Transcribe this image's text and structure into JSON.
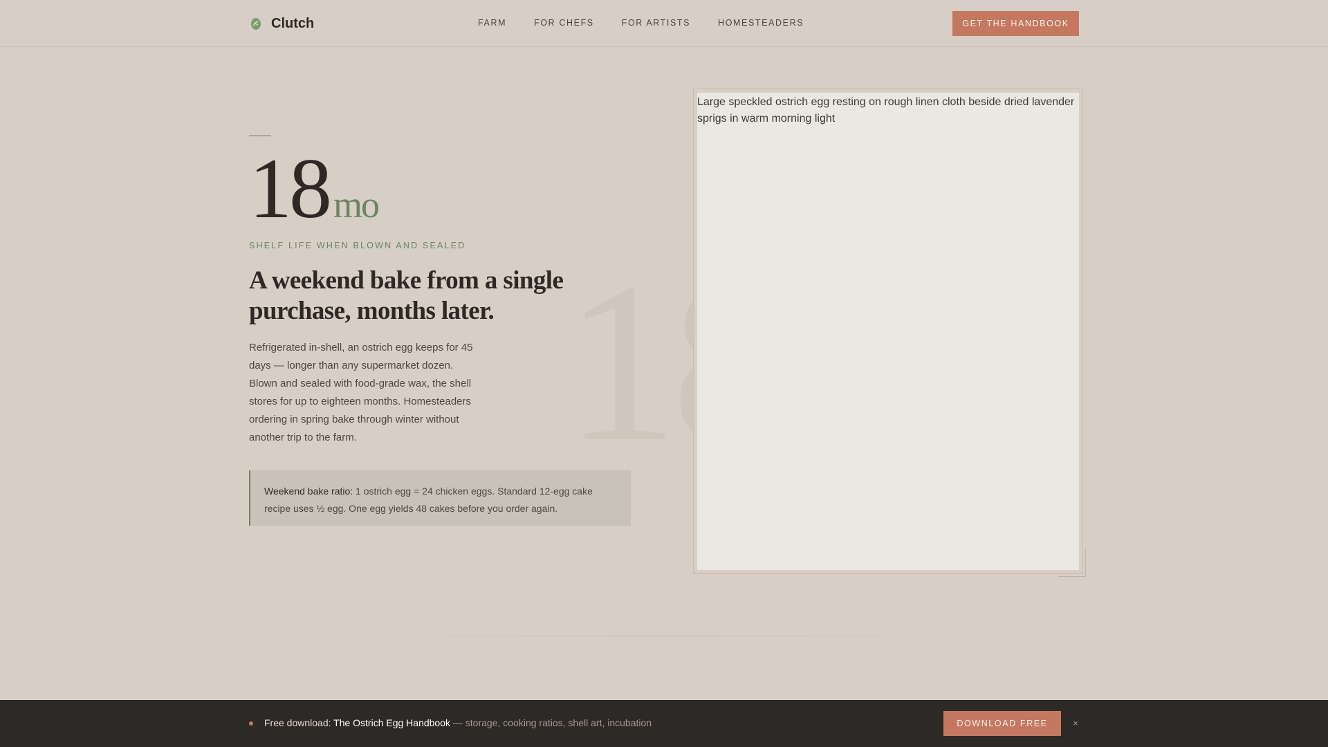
{
  "header": {
    "brand": "Clutch",
    "brand_icon": "egg-leaf-icon",
    "nav": [
      "FARM",
      "FOR CHEFS",
      "FOR ARTISTS",
      "HOMESTEADERS"
    ],
    "cta_label": "GET THE HANDBOOK"
  },
  "hero": {
    "stat_number": "18",
    "stat_unit": "mo",
    "stat_caption": "SHELF LIFE WHEN BLOWN AND SEALED",
    "headline": "A weekend bake from a single purchase, months later.",
    "body": "Refrigerated in-shell, an ostrich egg keeps for 45 days — longer than any supermarket dozen. Blown and sealed with food-grade wax, the shell stores for up to eighteen months. Homesteaders ordering in spring bake through winter without another trip to the farm.",
    "ghost_number": "18",
    "callout_label": "Weekend bake ratio:",
    "callout_text": " 1 ostrich egg = 24 chicken eggs. Standard 12-egg cake recipe uses ½ egg. One egg yields 48 cakes before you order again.",
    "image_alt": "Large speckled ostrich egg resting on rough linen cloth beside dried lavender sprigs in warm morning light"
  },
  "banner": {
    "prefix": "Free download: ",
    "title": "The Ostrich Egg Handbook",
    "tail": " — storage, cooking ratios, shell art, incubation",
    "button_label": "DOWNLOAD FREE",
    "close_label": "×"
  },
  "colors": {
    "background": "#d7cec6",
    "accent": "#c57860",
    "green": "#6d8463",
    "banner_bg": "#2d2926"
  }
}
